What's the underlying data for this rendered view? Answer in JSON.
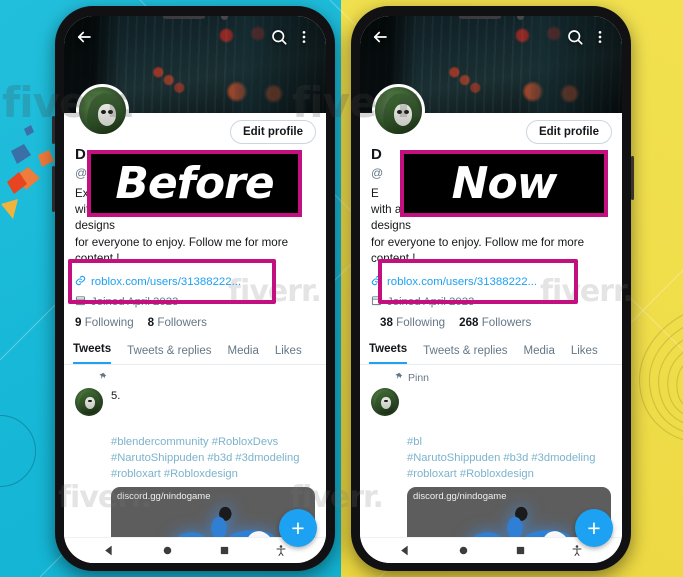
{
  "background": {
    "left_color": "#18b9d8",
    "right_color": "#efdd4a",
    "accent_color": "#c2107e",
    "brand_blue": "#1da1f2",
    "watermark_text": "fiverr."
  },
  "labels": {
    "before": "Before",
    "now": "Now"
  },
  "phones": [
    {
      "id": "before",
      "label": "Before",
      "topbar": {
        "back_icon": "arrow-left-icon",
        "search_icon": "search-icon",
        "more_icon": "more-vertical-icon"
      },
      "edit_profile_label": "Edit profile",
      "profile": {
        "display_name": "D",
        "handle": "@",
        "bio_line1": "Ex",
        "bio_line2": "with a passion for creating visually stunning designs",
        "bio_line3": "for everyone to enjoy.  Follow me for more content !",
        "link_icon": "link-icon",
        "link": "roblox.com/users/31388222...",
        "joined_icon": "calendar-icon",
        "joined": "Joined April 2023",
        "following_count": "9",
        "following_label": "Following",
        "followers_count": "8",
        "followers_label": "Followers"
      },
      "tabs": [
        {
          "label": "Tweets",
          "active": true
        },
        {
          "label": "Tweets & replies",
          "active": false
        },
        {
          "label": "Media",
          "active": false
        },
        {
          "label": "Likes",
          "active": false
        }
      ],
      "tweet": {
        "pinned_icon": "pin-icon",
        "pinned_label": "",
        "text": "5.",
        "tags_line1": "#blendercommunity #RobloxDevs",
        "tags_line2": "#NarutoShippuden  #b3d #3dmodeling",
        "tags_line3": "#robloxart #Robloxdesign",
        "media_url": "discord.gg/nindogame"
      },
      "fab_icon": "plus-icon",
      "navbar": {
        "back_icon": "triangle-back-icon",
        "home_icon": "circle-home-icon",
        "recents_icon": "square-recents-icon",
        "accessibility_icon": "accessibility-icon"
      }
    },
    {
      "id": "now",
      "label": "Now",
      "topbar": {
        "back_icon": "arrow-left-icon",
        "search_icon": "search-icon",
        "more_icon": "more-vertical-icon"
      },
      "edit_profile_label": "Edit profile",
      "profile": {
        "display_name": "D",
        "handle": "@",
        "bio_line1": "E",
        "bio_line2": "with a passion for creating visually stunning designs",
        "bio_line3": "for everyone to enjoy.  Follow me for more content !",
        "link_icon": "link-icon",
        "link": "roblox.com/users/31388222...",
        "joined_icon": "calendar-icon",
        "joined": "Joined April 2023",
        "following_count": "38",
        "following_label": "Following",
        "followers_count": "268",
        "followers_label": "Followers"
      },
      "tabs": [
        {
          "label": "Tweets",
          "active": true
        },
        {
          "label": "Tweets & replies",
          "active": false
        },
        {
          "label": "Media",
          "active": false
        },
        {
          "label": "Likes",
          "active": false
        }
      ],
      "tweet": {
        "pinned_icon": "pin-icon",
        "pinned_label": "Pinn",
        "text": "",
        "tags_line1": "#bl",
        "tags_line2": "#NarutoShippuden  #b3d #3dmodeling",
        "tags_line3": "#robloxart #Robloxdesign",
        "media_url": "discord.gg/nindogame"
      },
      "fab_icon": "plus-icon",
      "navbar": {
        "back_icon": "triangle-back-icon",
        "home_icon": "circle-home-icon",
        "recents_icon": "square-recents-icon",
        "accessibility_icon": "accessibility-icon"
      }
    }
  ]
}
